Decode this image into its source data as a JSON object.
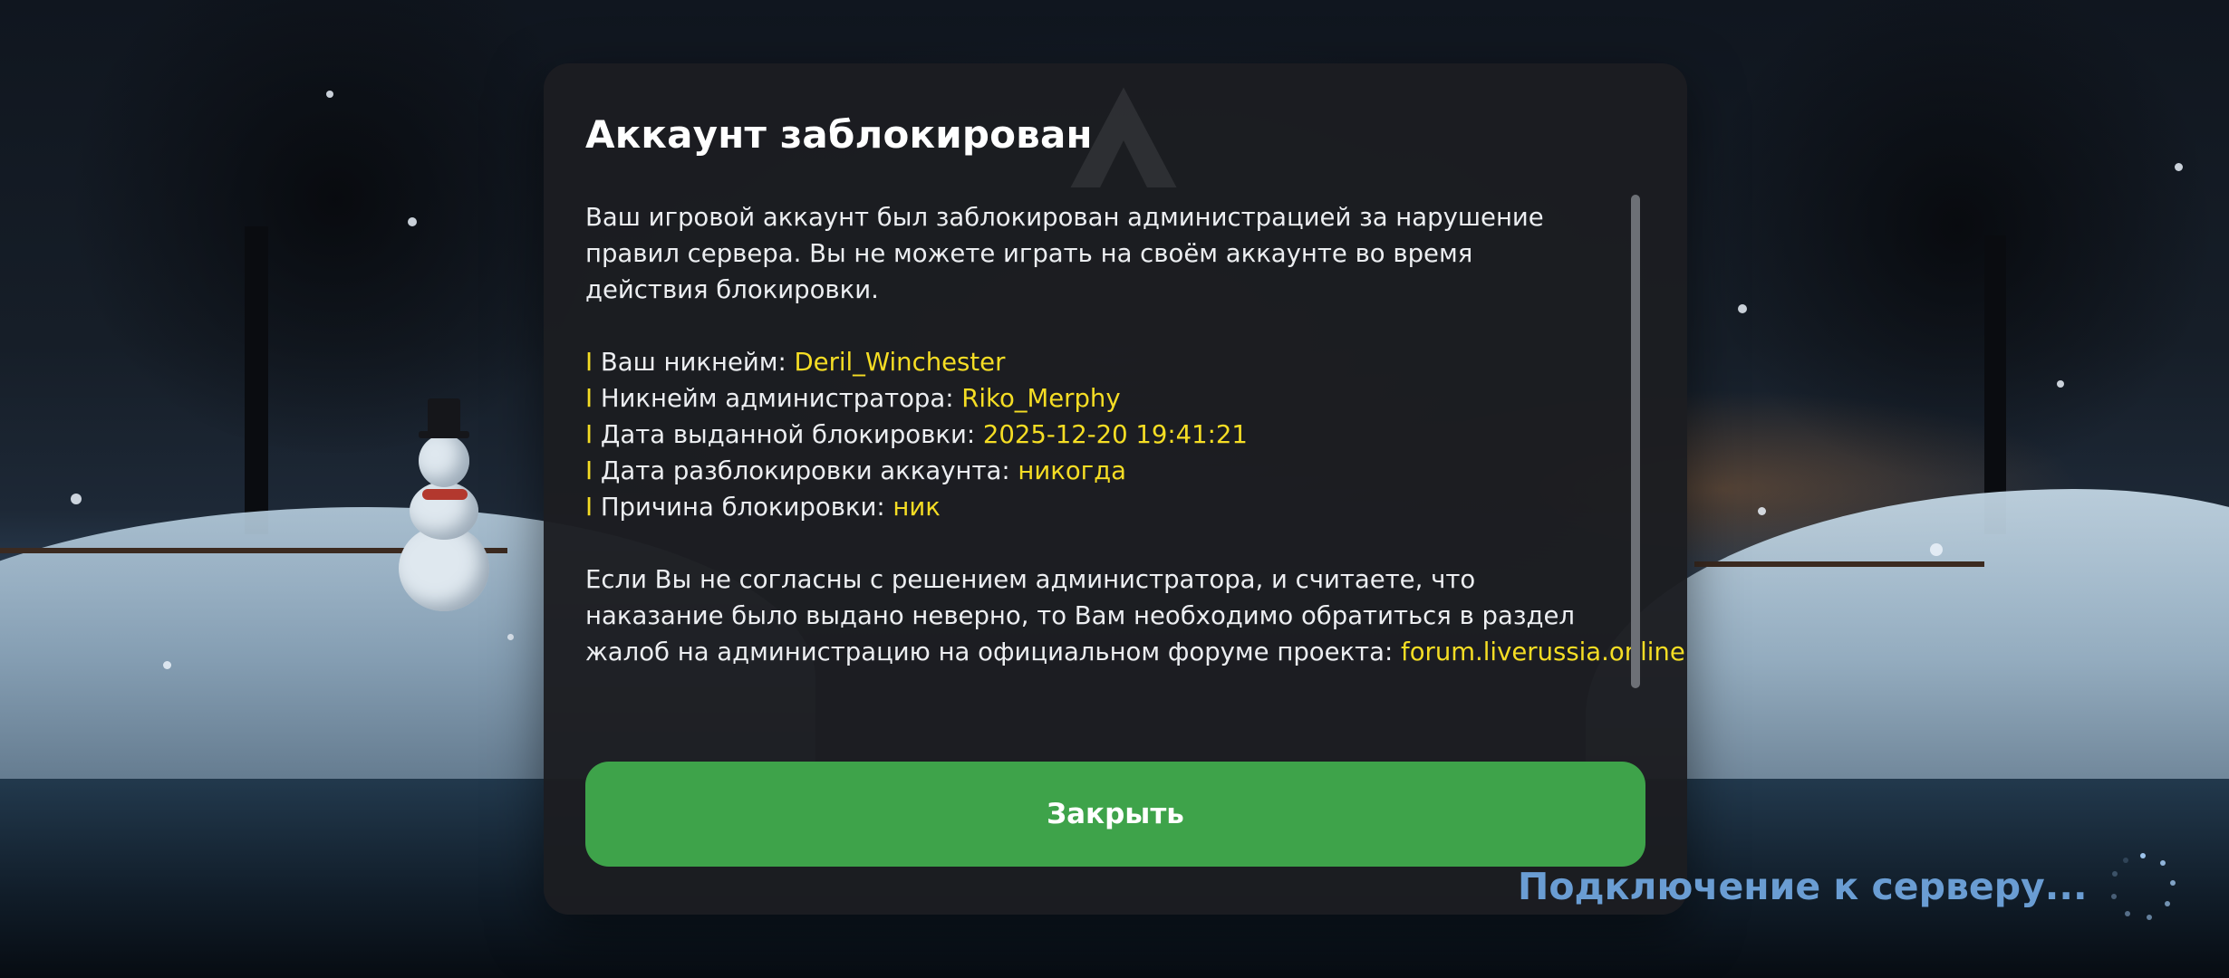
{
  "dialog": {
    "title": "Аккаунт заблокирован",
    "intro": [
      "Ваш игровой аккаунт был заблокирован администрацией за нарушение",
      "правил сервера. Вы не можете играть на своём аккаунте во время",
      "действия блокировки."
    ],
    "bullet_marker": "I",
    "details": [
      {
        "label": "Ваш никнейм: ",
        "value": "Deril_Winchester"
      },
      {
        "label": "Никнейм администратора: ",
        "value": "Riko_Merphy"
      },
      {
        "label": "Дата выданной блокировки: ",
        "value": "2025-12-20 19:41:21"
      },
      {
        "label": "Дата разблокировки аккаунта: ",
        "value": "никогда"
      },
      {
        "label": "Причина блокировки: ",
        "value": "ник"
      }
    ],
    "appeal": [
      "Если Вы не согласны с решением администратора, и считаете, что",
      "наказание было выдано неверно, то Вам необходимо обратиться в раздел",
      "жалоб на администрацию на официальном форуме проекта: "
    ],
    "forum_link": "forum.liverussia.online",
    "close_label": "Закрыть"
  },
  "status": {
    "connecting_text": "Подключение к серверу..."
  },
  "colors": {
    "accent_yellow": "#f5dd24",
    "button_green": "#3ea34a",
    "status_blue": "#6a9dd3",
    "dialog_bg": "#1c1d21"
  },
  "icons": {
    "logo": "project-logo-icon",
    "spinner": "loading-spinner-icon"
  }
}
